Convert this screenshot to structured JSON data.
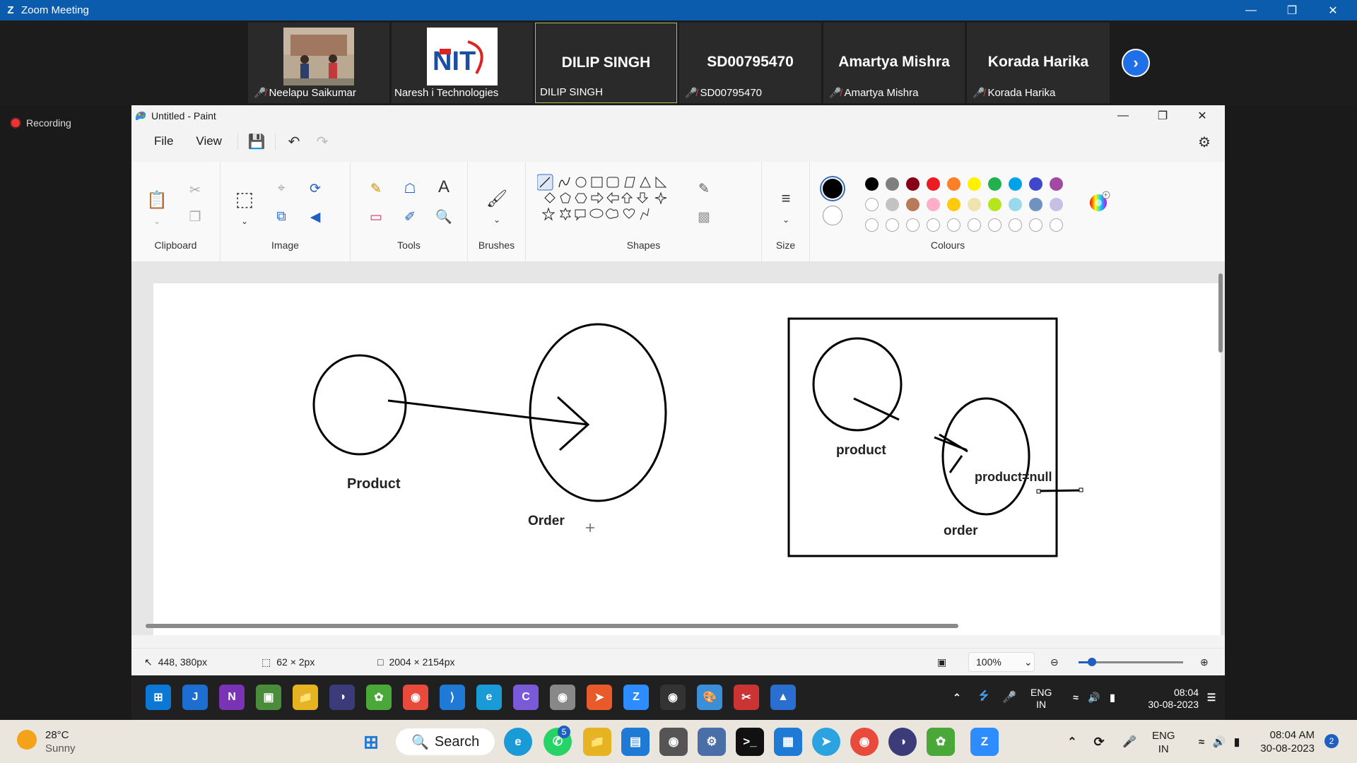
{
  "zoom": {
    "title": "Zoom Meeting",
    "participants": [
      {
        "name": "Neelapu Saikumar",
        "muted": true
      },
      {
        "name": "Naresh i Technologies",
        "muted": false
      },
      {
        "name": "DILIP SINGH",
        "big": "DILIP SINGH",
        "muted": false
      },
      {
        "name": "SD00795470",
        "big": "SD00795470",
        "muted": true
      },
      {
        "name": "Amartya Mishra",
        "big": "Amartya Mishra",
        "muted": true
      },
      {
        "name": "Korada Harika",
        "big": "Korada Harika",
        "muted": true
      }
    ],
    "recording": "Recording"
  },
  "paint": {
    "title": "Untitled - Paint",
    "menu": {
      "file": "File",
      "view": "View"
    },
    "groups": {
      "clipboard": "Clipboard",
      "image": "Image",
      "tools": "Tools",
      "brushes": "Brushes",
      "shapes": "Shapes",
      "size": "Size",
      "colours": "Colours"
    },
    "tool_text_icon": "A",
    "palette": {
      "row1": [
        "#000000",
        "#7f7f7f",
        "#880015",
        "#ed1c24",
        "#ff7f27",
        "#fff200",
        "#22b14c",
        "#00a2e8",
        "#3f48cc",
        "#a349a4"
      ],
      "row2": [
        "#ffffff",
        "#c3c3c3",
        "#b97a57",
        "#ffaec9",
        "#ffc90e",
        "#efe4b0",
        "#b5e61d",
        "#99d9ea",
        "#7092be",
        "#c8bfe7"
      ],
      "row3": [
        "",
        "",
        "",
        "",
        "",
        "",
        "",
        "",
        "",
        ""
      ]
    },
    "canvas": {
      "labels": {
        "product_left": "Product",
        "order_left": "Order",
        "product_right": "product",
        "product_null": "product=null",
        "order_right": "order"
      }
    },
    "status": {
      "cursor": "448, 380px",
      "selection": "62 × 2px",
      "canvas_size": "2004 × 2154px",
      "zoom": "100%"
    }
  },
  "inner_taskbar": {
    "lang": "ENG",
    "region": "IN",
    "time": "08:04",
    "date": "30-08-2023"
  },
  "taskbar": {
    "weather_temp": "28°C",
    "weather_desc": "Sunny",
    "search": "Search",
    "whatsapp_badge": "5",
    "lang": "ENG",
    "region": "IN",
    "time": "08:04 AM",
    "date": "30-08-2023",
    "notif": "2"
  }
}
